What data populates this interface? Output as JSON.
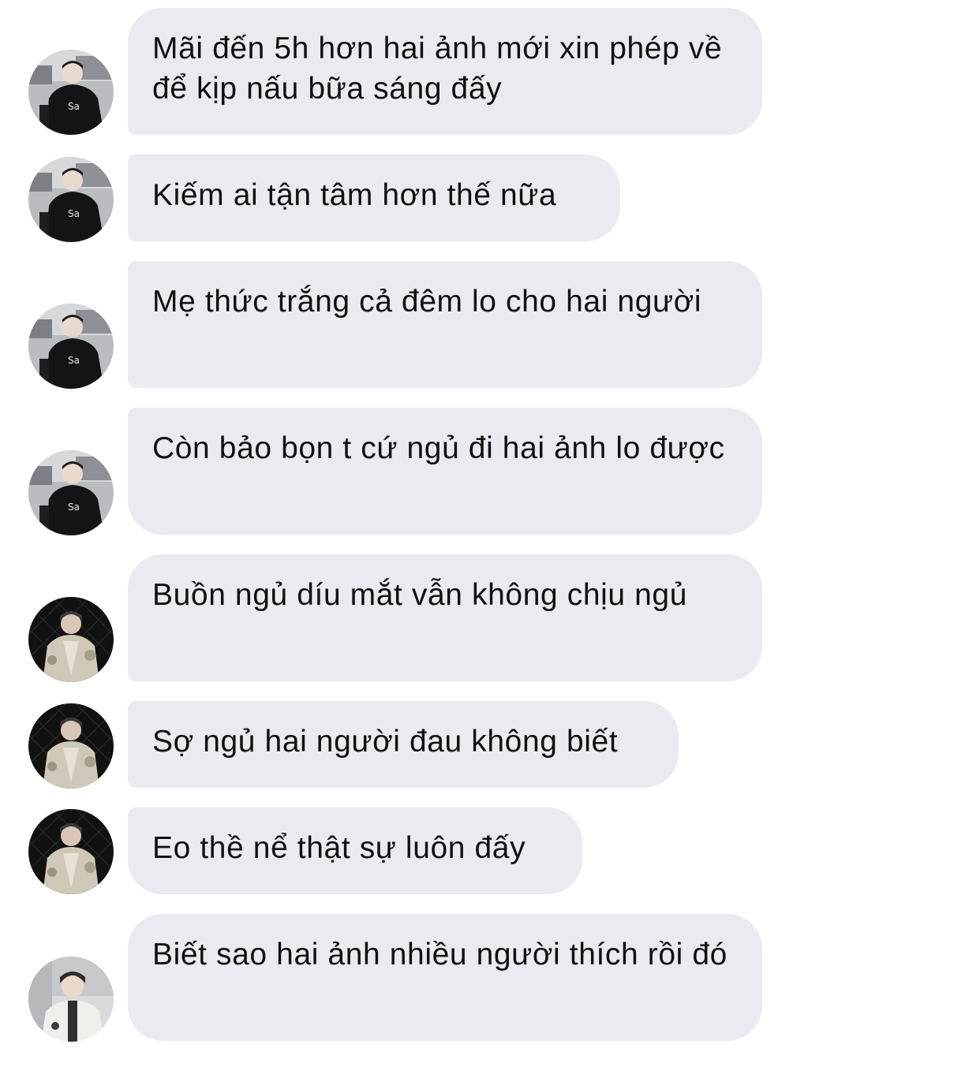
{
  "messages": [
    {
      "sender": "user-1",
      "text": "Mãi đến 5h hơn hai ảnh mới xin phép về để kịp nấu bữa sáng đấy"
    },
    {
      "sender": "user-1",
      "text": "Kiếm ai tận tâm hơn thế nữa"
    },
    {
      "sender": "user-1",
      "text": "Mẹ thức trắng cả đêm lo cho hai người"
    },
    {
      "sender": "user-1",
      "text": "Còn bảo bọn t cứ ngủ đi hai ảnh lo được"
    },
    {
      "sender": "user-2",
      "text": "Buồn ngủ díu mắt vẫn không chịu ngủ"
    },
    {
      "sender": "user-2",
      "text": "Sợ ngủ hai người đau không biết"
    },
    {
      "sender": "user-2",
      "text": "Eo thề nể thật sự luôn đấy"
    },
    {
      "sender": "user-3",
      "text": "Biết sao hai ảnh nhiều người thích rồi đó"
    }
  ],
  "colors": {
    "bubble": "#e9ebf0",
    "text": "#111111",
    "background": "#ffffff"
  },
  "icons": {
    "user-1": "avatar-hoodie-street-photo",
    "user-2": "avatar-dark-fence-photo",
    "user-3": "avatar-light-jacket-photo"
  }
}
